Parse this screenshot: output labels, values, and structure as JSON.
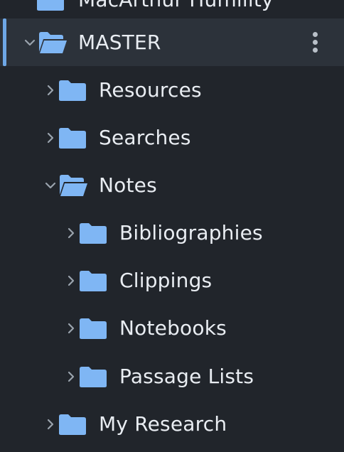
{
  "tree": {
    "items": [
      {
        "label": "MacArthur Humility",
        "state": "collapsed",
        "icon": "folder-icon"
      },
      {
        "label": "MASTER",
        "state": "expanded",
        "selected": true,
        "icon": "folder-open-icon"
      },
      {
        "label": "Resources",
        "state": "collapsed",
        "icon": "folder-icon"
      },
      {
        "label": "Searches",
        "state": "collapsed",
        "icon": "folder-icon"
      },
      {
        "label": "Notes",
        "state": "expanded",
        "icon": "folder-open-icon"
      },
      {
        "label": "Bibliographies",
        "state": "collapsed",
        "icon": "folder-icon"
      },
      {
        "label": "Clippings",
        "state": "collapsed",
        "icon": "folder-icon"
      },
      {
        "label": "Notebooks",
        "state": "collapsed",
        "icon": "folder-icon"
      },
      {
        "label": "Passage Lists",
        "state": "collapsed",
        "icon": "folder-icon"
      },
      {
        "label": "My Research",
        "state": "collapsed",
        "icon": "folder-icon"
      }
    ],
    "more_options_icon": "kebab-menu-icon"
  },
  "colors": {
    "background": "#21252b",
    "selected_row": "#2c323a",
    "accent": "#6ea7e6",
    "folder": "#7fb6f4",
    "text": "#e9edf2",
    "chevron": "#9aa3ad"
  }
}
